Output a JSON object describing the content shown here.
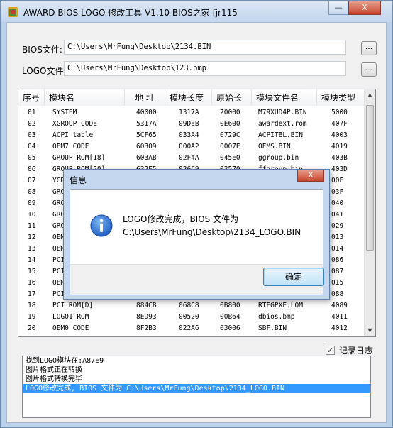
{
  "window": {
    "title": "AWARD BIOS LOGO 修改工具  V1.10  BIOS之家  fjr115",
    "controls": {
      "minimize": "—",
      "close": "X"
    }
  },
  "form": {
    "bios_label": "BIOS文件:",
    "bios_path": "C:\\Users\\MrFung\\Desktop\\2134.BIN",
    "logo_label": "LOGO文件:",
    "logo_path": "C:\\Users\\MrFung\\Desktop\\123.bmp",
    "browse_label": "..."
  },
  "table": {
    "columns": [
      "序号",
      "模块名",
      "地  址",
      "模块长度",
      "原始长",
      "模块文件名",
      "模块类型"
    ],
    "rows": [
      [
        "01",
        "SYSTEM",
        "40000",
        "1317A",
        "20000",
        "M79XUD4P.BIN",
        "5000"
      ],
      [
        "02",
        "XGROUP CODE",
        "5317A",
        "09DEB",
        "0E600",
        "awardext.rom",
        "407F"
      ],
      [
        "03",
        "ACPI table",
        "5CF65",
        "033A4",
        "0729C",
        "ACPITBL.BIN",
        "4003"
      ],
      [
        "04",
        "OEM7 CODE",
        "60309",
        "000A2",
        "0007E",
        "OEMS.BIN",
        "4019"
      ],
      [
        "05",
        "GROUP ROM[18]",
        "603AB",
        "02F4A",
        "045E0",
        "ggroup.bin",
        "403B"
      ],
      [
        "06",
        "GROUP ROM[20]",
        "632F5",
        "026C9",
        "03570",
        "ffgroup.bin",
        "403D"
      ],
      [
        "07",
        "YGRO",
        "",
        "",
        "",
        "",
        "00E"
      ],
      [
        "08",
        "GROU",
        "",
        "",
        "",
        "",
        "03F"
      ],
      [
        "09",
        "GROU",
        "",
        "",
        "",
        "",
        "040"
      ],
      [
        "10",
        "GROU",
        "",
        "",
        "",
        "",
        "041"
      ],
      [
        "11",
        "GROU",
        "",
        "",
        "",
        "",
        "029"
      ],
      [
        "12",
        "OEM1",
        "",
        "",
        "",
        "",
        "013"
      ],
      [
        "13",
        "OEM2",
        "",
        "",
        "",
        "",
        "014"
      ],
      [
        "14",
        "PCI",
        "",
        "",
        "",
        "",
        "086"
      ],
      [
        "15",
        "PCI",
        "",
        "",
        "",
        "",
        "087"
      ],
      [
        "16",
        "OEM3",
        "",
        "",
        "",
        "",
        "015"
      ],
      [
        "17",
        "PCI",
        "",
        "",
        "",
        "",
        "088"
      ],
      [
        "18",
        "PCI ROM[D]",
        "884CB",
        "068C8",
        "0B800",
        "RTEGPXE.LOM",
        "4089"
      ],
      [
        "19",
        "LOGO1 ROM",
        "8ED93",
        "00520",
        "00B64",
        "dbios.bmp",
        "4011"
      ],
      [
        "20",
        "OEM0 CODE",
        "8F2B3",
        "022A6",
        "03006",
        "SBF.BIN",
        "4012"
      ]
    ]
  },
  "options": {
    "log_checkbox_label": "记录日志",
    "log_checked": true
  },
  "log": {
    "lines": [
      "找到LOGO模块在:A87E9",
      "图片格式正在转换",
      "图片格式转换完毕",
      "LOGO修改完成, BIOS 文件为 C:\\Users\\MrFung\\Desktop\\2134_LOGO.BIN"
    ],
    "selected_index": 3
  },
  "dialog": {
    "title": "信息",
    "close": "X",
    "message_line1": "LOGO修改完成，BIOS 文件为",
    "message_line2": "C:\\Users\\MrFung\\Desktop\\2134_LOGO.BIN",
    "ok_label": "确定",
    "icon": "info-icon"
  },
  "colors": {
    "accent": "#3399ff",
    "info_icon": "#1f5fc4"
  }
}
